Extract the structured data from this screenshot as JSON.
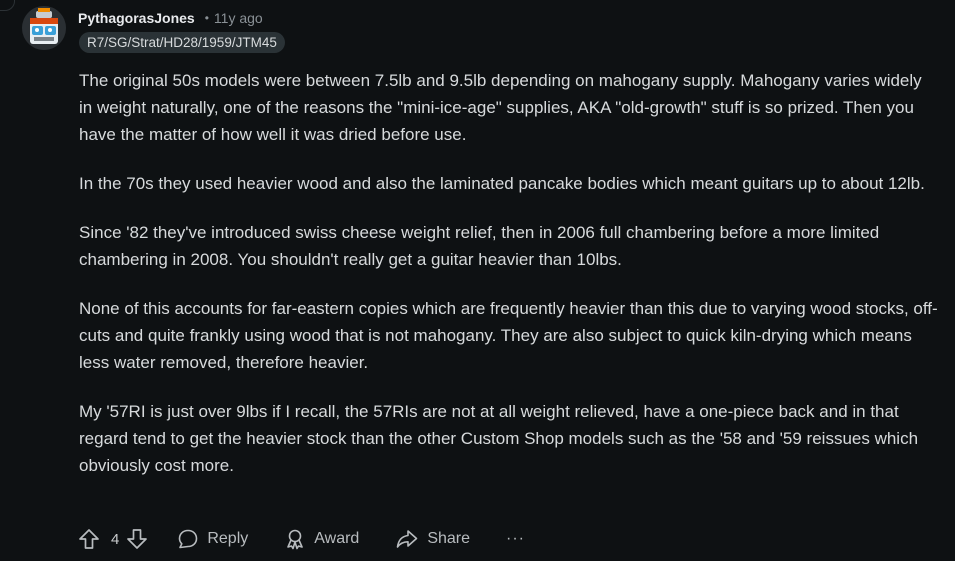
{
  "comment": {
    "username": "PythagorasJones",
    "separator": "•",
    "time": "11y ago",
    "flair": "R7/SG/Strat/HD28/1959/JTM45",
    "paragraphs": [
      "The original 50s models were between 7.5lb and 9.5lb depending on mahogany supply. Mahogany varies widely in weight naturally, one of the reasons the \"mini-ice-age\" supplies, AKA \"old-growth\" stuff is so prized. Then you have the matter of how well it was dried before use.",
      "In the 70s they used heavier wood and also the laminated pancake bodies which meant guitars up to about 12lb.",
      "Since '82 they've introduced swiss cheese weight relief, then in 2006 full chambering before a more limited chambering in 2008. You shouldn't really get a guitar heavier than 10lbs.",
      "None of this accounts for far-eastern copies which are frequently heavier than this due to varying wood stocks, off-cuts and quite frankly using wood that is not mahogany. They are also subject to quick kiln-drying which means less water removed, therefore heavier.",
      "My '57RI is just over 9lbs if I recall, the 57RIs are not at all weight relieved, have a one-piece back and in that regard tend to get the heavier stock than the other Custom Shop models such as the '58 and '59 reissues which obviously cost more."
    ]
  },
  "actions": {
    "vote_count": "4",
    "reply_label": "Reply",
    "award_label": "Award",
    "share_label": "Share",
    "more_label": "···"
  },
  "icons": {
    "upvote": "upvote-icon",
    "downvote": "downvote-icon",
    "reply": "comment-bubble-icon",
    "award": "award-icon",
    "share": "share-arrow-icon",
    "more": "ellipsis-icon"
  },
  "colors": {
    "background": "#0e1113",
    "text": "#d7dadc",
    "muted": "#8a9196",
    "flair_bg": "#2a3236"
  }
}
